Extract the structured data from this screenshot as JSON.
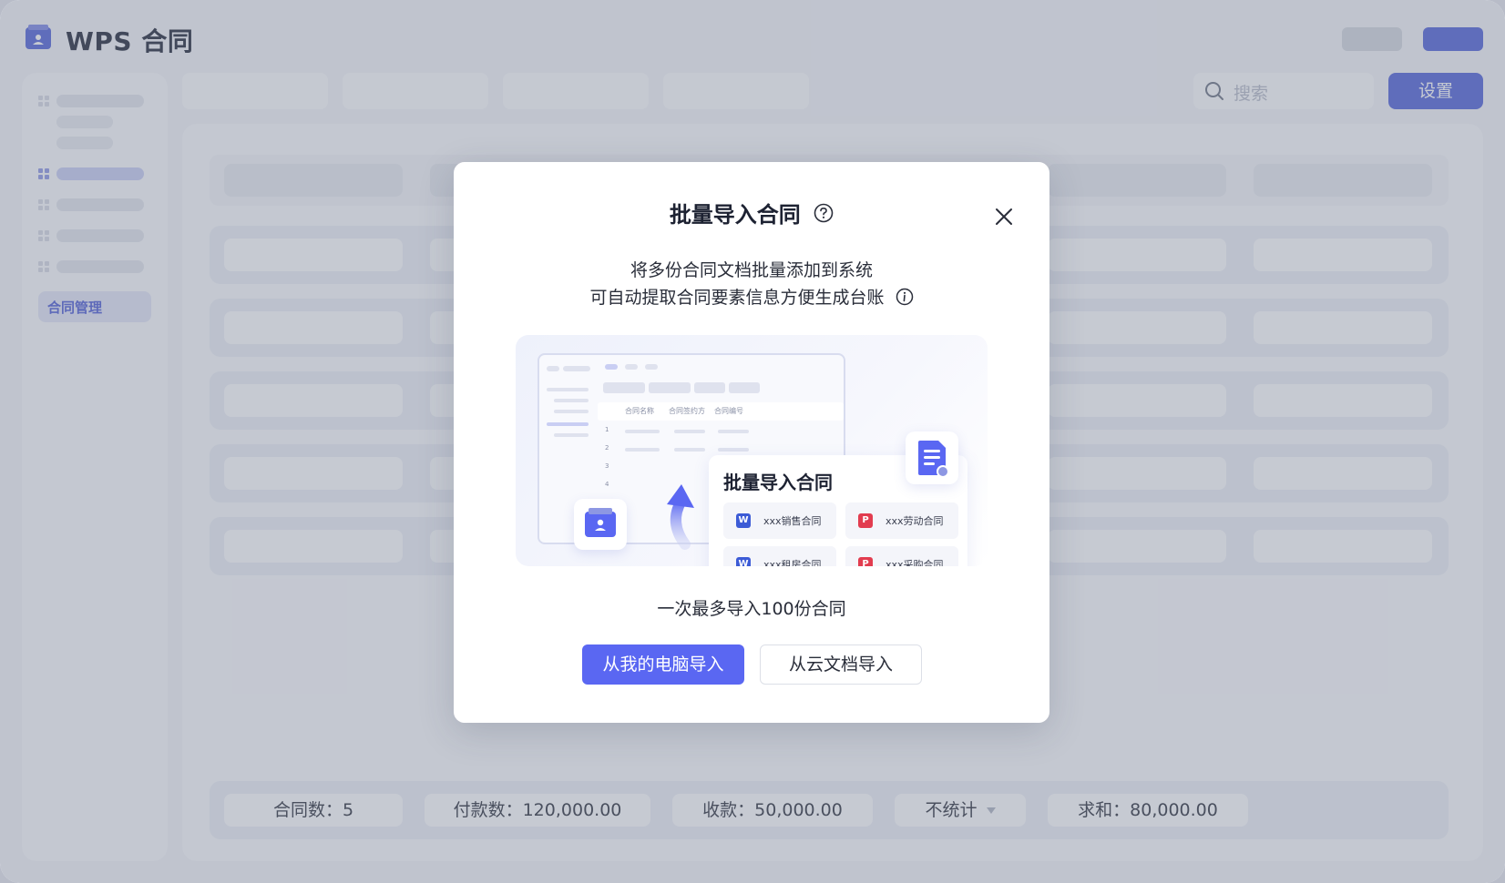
{
  "app": {
    "title": "WPS 合同"
  },
  "toolbar": {
    "search_placeholder": "搜索",
    "settings_label": "设置"
  },
  "sidebar": {
    "menu_label": "合同管理"
  },
  "footer": {
    "count": "合同数：5",
    "payment": "付款数：120,000.00",
    "receipt": "收款：50,000.00",
    "mode": "不统计",
    "sum": "求和：80,000.00"
  },
  "modal": {
    "title": "批量导入合同",
    "desc_line1": "将多份合同文档批量添加到系统",
    "desc_line2": "可自动提取合同要素信息方便生成台账",
    "limit_text": "一次最多导入100份合同",
    "btn_local": "从我的电脑导入",
    "btn_cloud": "从云文档导入",
    "illustration": {
      "card_title": "批量导入合同",
      "table_headers": [
        "合同名称",
        "合同签约方",
        "合同编号"
      ],
      "row_numbers": [
        "1",
        "2",
        "3",
        "4"
      ],
      "files": [
        {
          "name": "xxx销售合同",
          "type": "W"
        },
        {
          "name": "xxx劳动合同",
          "type": "P"
        },
        {
          "name": "xxx租房合同",
          "type": "W"
        },
        {
          "name": "xxx采购合同",
          "type": "P"
        }
      ]
    }
  },
  "colors": {
    "accent": "#4f5fd8",
    "primary_button": "#5a67f2",
    "word_badge": "#3c5bd6",
    "pdf_badge": "#e23c4f"
  }
}
